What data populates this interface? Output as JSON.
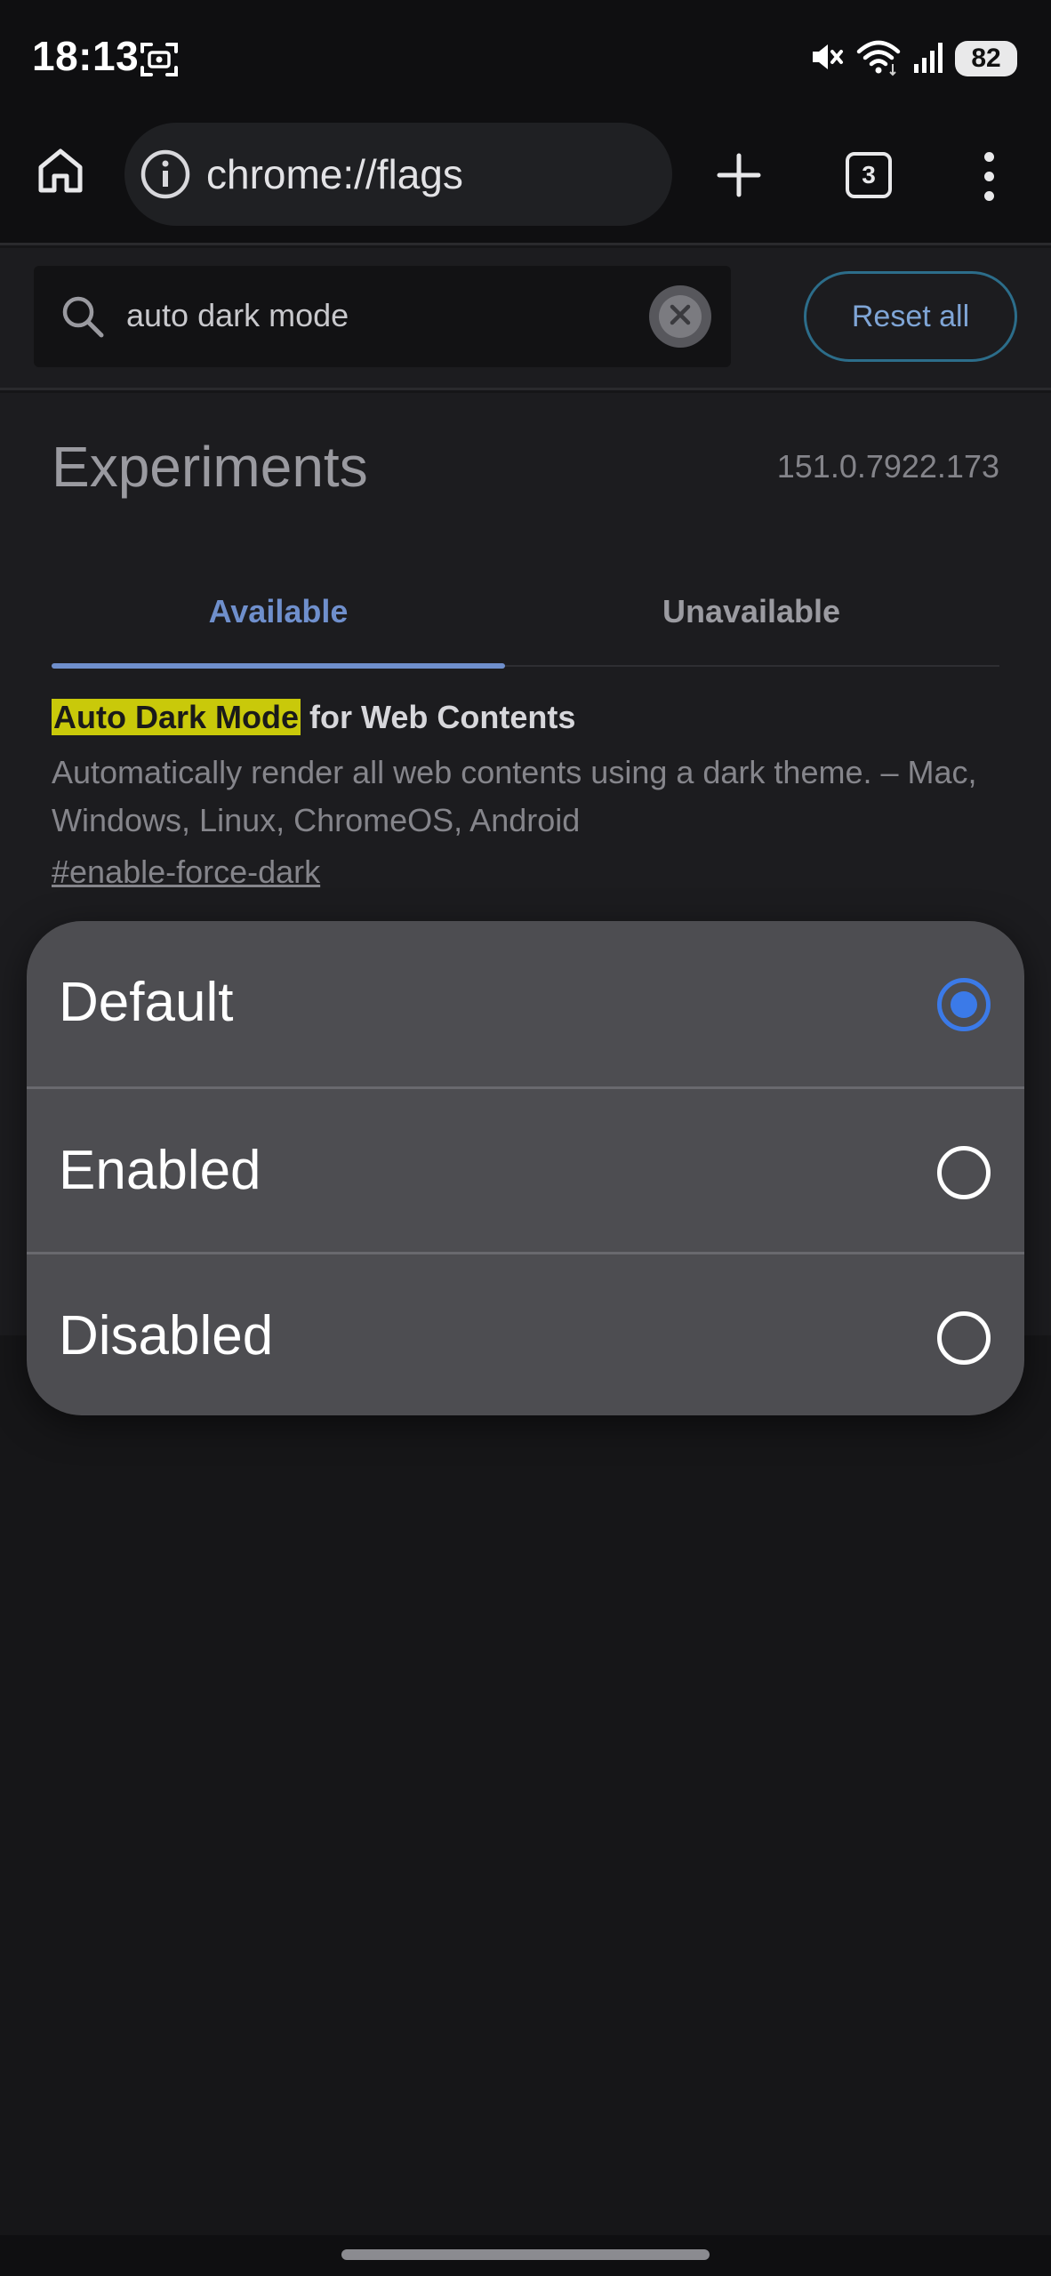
{
  "status_bar": {
    "time": "18:13",
    "screenshot_icon": "screenshot-icon",
    "mute_icon": "mute-icon",
    "wifi_icon": "wifi-icon",
    "signal_icon": "signal-icon",
    "battery": "82"
  },
  "toolbar": {
    "home_icon": "home-icon",
    "info_icon": "info-icon",
    "url": "chrome://flags",
    "new_tab_icon": "plus-icon",
    "tab_count": "3",
    "menu_icon": "more-vertical-icon"
  },
  "search": {
    "value": "auto dark mode",
    "icon": "search-icon",
    "clear_icon": "clear-icon",
    "reset_label": "Reset all"
  },
  "experiments": {
    "title": "Experiments",
    "version": "151.0.7922.173",
    "tabs": [
      {
        "label": "Available",
        "selected": true
      },
      {
        "label": "Unavailable",
        "selected": false
      }
    ]
  },
  "flag": {
    "name_highlight": "Auto Dark Mode",
    "name_rest": " for Web Contents",
    "description": "Automatically render all web contents using a dark theme. – Mac, Windows, Linux, ChromeOS, Android",
    "link": "#enable-force-dark"
  },
  "popup": {
    "options": [
      {
        "label": "Default",
        "selected": true
      },
      {
        "label": "Enabled",
        "selected": false
      },
      {
        "label": "Disabled",
        "selected": false
      }
    ],
    "accent_color": "#3b7ae8"
  }
}
